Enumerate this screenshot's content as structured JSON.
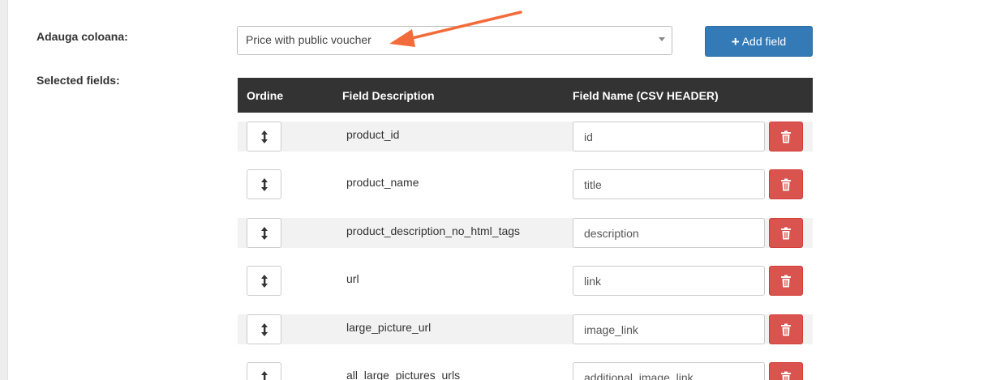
{
  "form": {
    "add_column_label": "Adauga coloana:",
    "selected_fields_label": "Selected fields:",
    "column_select_value": "Price with public voucher",
    "add_field_label": "Add field",
    "arrow_color": "#f26b3a",
    "accent_color": "#337ab7",
    "danger_color": "#d9534f"
  },
  "table": {
    "headers": [
      "Ordine",
      "Field Description",
      "Field Name (CSV HEADER)"
    ],
    "rows": [
      {
        "description": "product_id",
        "field_name": "id",
        "shaded": true
      },
      {
        "description": "product_name",
        "field_name": "title",
        "shaded": false
      },
      {
        "description": "product_description_no_html_tags",
        "field_name": "description",
        "shaded": true
      },
      {
        "description": "url",
        "field_name": "link",
        "shaded": false
      },
      {
        "description": "large_picture_url",
        "field_name": "image_link",
        "shaded": true
      },
      {
        "description": "all_large_pictures_urls",
        "field_name": "additional_image_link",
        "shaded": false
      }
    ],
    "row_icons": {
      "sort": "sort-vertical-icon",
      "delete": "trash-icon"
    }
  }
}
